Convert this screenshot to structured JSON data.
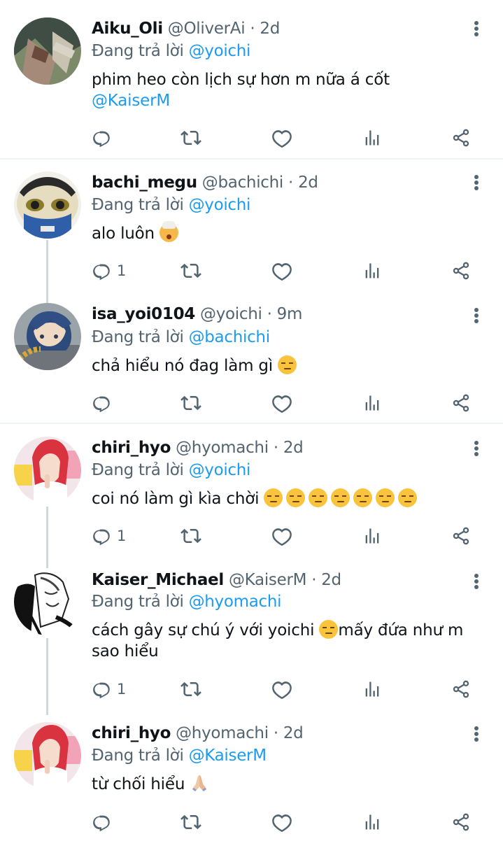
{
  "reply_prefix": "Đang trả lời",
  "icons": {
    "reply": "reply-icon",
    "retweet": "retweet-icon",
    "like": "heart-icon",
    "views": "bar-chart-icon",
    "share": "share-icon",
    "more": "more-vertical-icon"
  },
  "colors": {
    "mention": "#1d9bf0",
    "meta": "#536471",
    "thread_line": "#cfd9de"
  },
  "tweets": [
    {
      "name": "Aiku_Oli",
      "handle": "@OliverAi",
      "time": "· 2d",
      "replying_to": "@yoichi",
      "text": "phim heo còn lịch sự hơn m nữa á cốt",
      "text_mention": "@KaiserM",
      "reply_count": ""
    },
    {
      "name": "bachi_megu",
      "handle": "@bachichi",
      "time": "· 2d",
      "replying_to": "@yoichi",
      "text": "alo luôn",
      "emoji": "exploding-head-emoji",
      "reply_count": "1"
    },
    {
      "name": "isa_yoi0104",
      "handle": "@yoichi",
      "time": "· 9m",
      "replying_to": "@bachichi",
      "text": "chả hiểu nó đag làm gì",
      "emoji": "unamused-face-emoji",
      "reply_count": ""
    },
    {
      "name": "chiri_hyo",
      "handle": "@hyomachi",
      "time": "· 2d",
      "replying_to": "@yoichi",
      "text": "coi nó làm gì kìa chời",
      "emoji": "unamused-face-emoji x7",
      "reply_count": "1"
    },
    {
      "name": "Kaiser_Michael",
      "handle": "@KaiserM",
      "time": "· 2d",
      "replying_to": "@hyomachi",
      "text": "cách gây sự chú ý với yoichi",
      "text_after": "mấy đứa như m sao hiểu",
      "emoji": "unamused-face-emoji",
      "reply_count": "1"
    },
    {
      "name": "chiri_hyo",
      "handle": "@hyomachi",
      "time": "· 2d",
      "replying_to": "@KaiserM",
      "text": "từ chối hiểu",
      "emoji": "folded-hands-emoji",
      "reply_count": ""
    }
  ]
}
